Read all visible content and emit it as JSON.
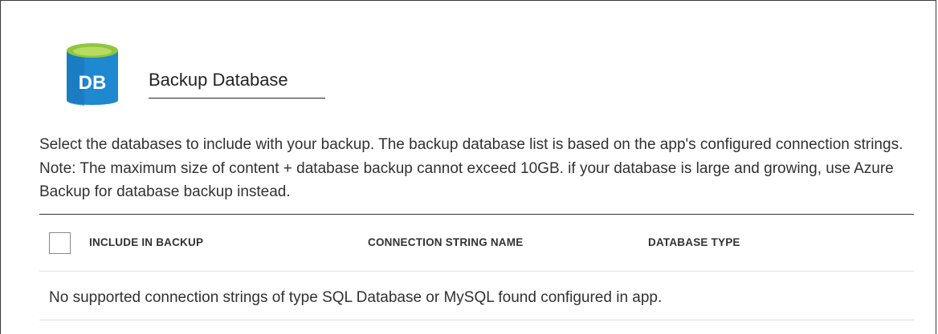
{
  "section": {
    "title": "Backup Database",
    "icon": "database-icon",
    "icon_text": "DB",
    "description": "Select the databases to include with your backup. The backup database list is based on the app's configured connection strings. Note: The maximum size of content + database backup cannot exceed 10GB. if your database is large and growing, use Azure Backup for database backup instead."
  },
  "table": {
    "columns": [
      "INCLUDE IN BACKUP",
      "CONNECTION STRING NAME",
      "DATABASE TYPE"
    ],
    "select_all_checked": false,
    "empty_message": "No supported connection strings of type SQL Database or MySQL found configured in app."
  },
  "colors": {
    "db_icon_blue": "#1e88d0",
    "db_icon_green": "#8fc63f",
    "text": "#323130",
    "divider": "#e1dfdd"
  }
}
